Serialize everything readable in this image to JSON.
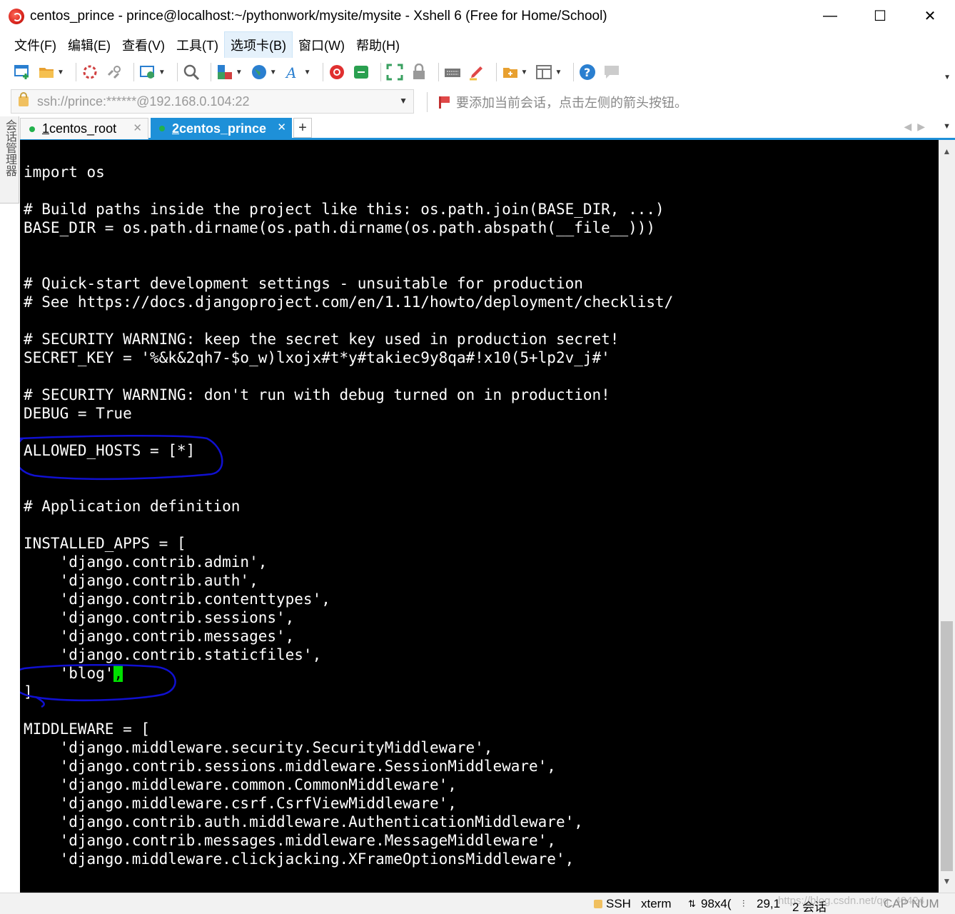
{
  "window": {
    "title": "centos_prince - prince@localhost:~/pythonwork/mysite/mysite - Xshell 6 (Free for Home/School)",
    "minimize": "—",
    "maximize": "☐",
    "close": "✕"
  },
  "menu": [
    "文件(F)",
    "编辑(E)",
    "查看(V)",
    "工具(T)",
    "选项卡(B)",
    "窗口(W)",
    "帮助(H)"
  ],
  "address": {
    "value": "ssh://prince:******@192.168.0.104:22",
    "hint": "要添加当前会话，点击左侧的箭头按钮。"
  },
  "side_tab": "会话管理器",
  "tabs": [
    {
      "number": "1",
      "label": " centos_root"
    },
    {
      "number": "2",
      "label": " centos_prince"
    }
  ],
  "tab_add": "+",
  "terminal_lines": [
    "import os",
    "",
    "# Build paths inside the project like this: os.path.join(BASE_DIR, ...)",
    "BASE_DIR = os.path.dirname(os.path.dirname(os.path.abspath(__file__)))",
    "",
    "",
    "# Quick-start development settings - unsuitable for production",
    "# See https://docs.djangoproject.com/en/1.11/howto/deployment/checklist/",
    "",
    "# SECURITY WARNING: keep the secret key used in production secret!",
    "SECRET_KEY = '%&k&2qh7-$o_w)lxojx#t*y#takiec9y8qa#!x10(5+lp2v_j#'",
    "",
    "# SECURITY WARNING: don't run with debug turned on in production!",
    "DEBUG = True",
    "",
    "ALLOWED_HOSTS = [*]",
    "",
    "",
    "# Application definition",
    "",
    "INSTALLED_APPS = [",
    "    'django.contrib.admin',",
    "    'django.contrib.auth',",
    "    'django.contrib.contenttypes',",
    "    'django.contrib.sessions',",
    "    'django.contrib.messages',",
    "    'django.contrib.staticfiles',",
    "    'blog'",
    "]",
    "",
    "MIDDLEWARE = [",
    "    'django.middleware.security.SecurityMiddleware',",
    "    'django.contrib.sessions.middleware.SessionMiddleware',",
    "    'django.middleware.common.CommonMiddleware',",
    "    'django.middleware.csrf.CsrfViewMiddleware',",
    "    'django.contrib.auth.middleware.AuthenticationMiddleware',",
    "    'django.contrib.messages.middleware.MessageMiddleware',",
    "    'django.middleware.clickjacking.XFrameOptionsMiddleware',"
  ],
  "cursor_char": ",",
  "cursor_line": 27,
  "status": {
    "protocol": "SSH",
    "terminal": "xterm",
    "size": "98x4(",
    "position": "29,1",
    "sessions": "2 会话",
    "caps": "CAP",
    "num": "NUM",
    "watermark": "https://blog.csdn.net/qq_40424"
  }
}
